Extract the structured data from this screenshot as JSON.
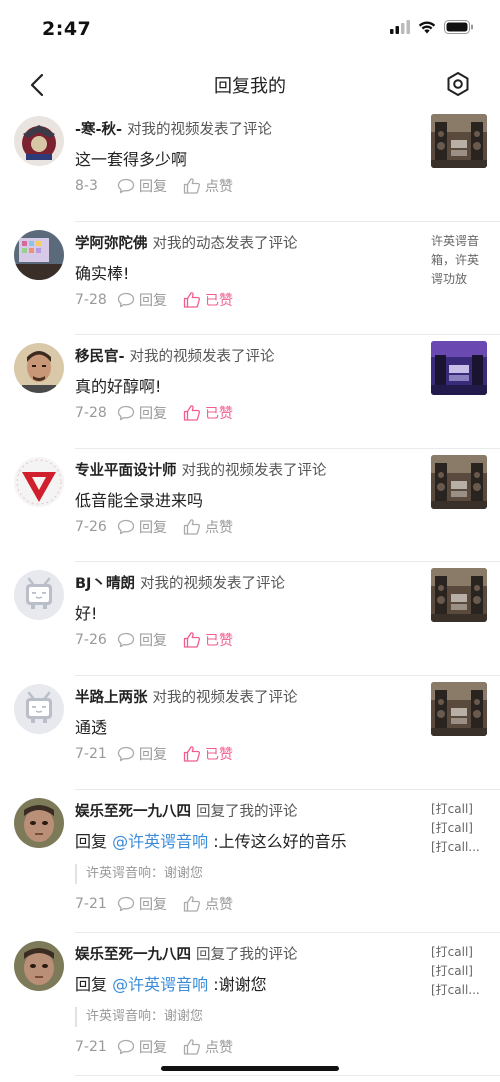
{
  "status_bar": {
    "time": "2:47"
  },
  "nav": {
    "title": "回复我的"
  },
  "items": [
    {
      "username": "-寒-秋-",
      "action": "对我的视频发表了评论",
      "comment": "这一套得多少啊",
      "date": "8-3",
      "reply_label": "回复",
      "like_label": "点赞",
      "liked": false,
      "thumb_type": "video"
    },
    {
      "username": "学阿弥陀佛",
      "action": "对我的动态发表了评论",
      "comment": "确实棒!",
      "date": "7-28",
      "reply_label": "回复",
      "like_label": "已赞",
      "liked": true,
      "side_lines": [
        "许英谔音",
        "箱，许英",
        "谔功放"
      ]
    },
    {
      "username": "移民官-",
      "action": "对我的视频发表了评论",
      "comment": "真的好醇啊!",
      "date": "7-28",
      "reply_label": "回复",
      "like_label": "已赞",
      "liked": true,
      "thumb_type": "video-purple"
    },
    {
      "username": "专业平面设计师",
      "action": "对我的视频发表了评论",
      "comment": "低音能全录进来吗",
      "date": "7-26",
      "reply_label": "回复",
      "like_label": "点赞",
      "liked": false,
      "thumb_type": "video"
    },
    {
      "username": "BJ丶晴朗",
      "action": "对我的视频发表了评论",
      "comment": "好!",
      "date": "7-26",
      "reply_label": "回复",
      "like_label": "已赞",
      "liked": true,
      "thumb_type": "video"
    },
    {
      "username": "半路上两张",
      "action": "对我的视频发表了评论",
      "comment": "通透",
      "date": "7-21",
      "reply_label": "回复",
      "like_label": "已赞",
      "liked": true,
      "thumb_type": "video"
    },
    {
      "username": "娱乐至死一九八四",
      "action": "回复了我的评论",
      "comment_prefix": "回复",
      "mention": "@许英谔音响",
      "comment": ":上传这么好的音乐",
      "quote": "许英谔音响：谢谢您",
      "date": "7-21",
      "reply_label": "回复",
      "like_label": "点赞",
      "liked": false,
      "side_lines": [
        "[打call]",
        "[打call]",
        "[打call..."
      ]
    },
    {
      "username": "娱乐至死一九八四",
      "action": "回复了我的评论",
      "comment_prefix": "回复",
      "mention": "@许英谔音响",
      "comment": ":谢谢您",
      "quote": "许英谔音响：谢谢您",
      "date": "7-21",
      "reply_label": "回复",
      "like_label": "点赞",
      "liked": false,
      "side_lines": [
        "[打call]",
        "[打call]",
        "[打call..."
      ]
    }
  ],
  "colors": {
    "liked": "#f25d8e",
    "mention": "#3b8cd8",
    "muted": "#999999",
    "divider": "#ebebeb"
  }
}
